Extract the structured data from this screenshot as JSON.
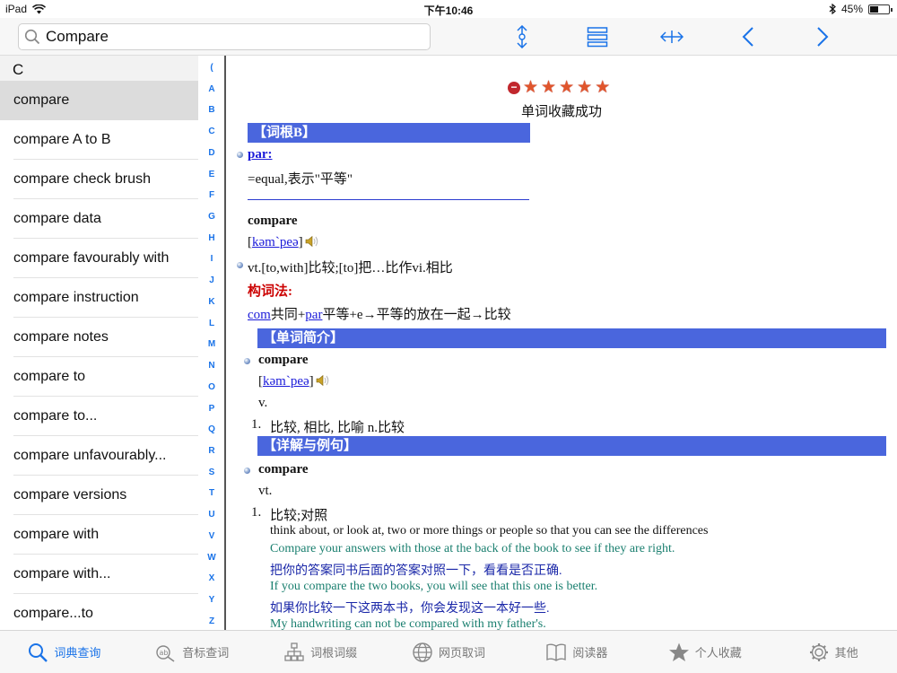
{
  "status_bar": {
    "device": "iPad",
    "time": "下午10:46",
    "battery_text": "45%",
    "battery_level": 0.45
  },
  "search": {
    "value": "Compare",
    "placeholder": ""
  },
  "toolbar": {
    "icons": [
      "expand-vertical-icon",
      "list-icon",
      "expand-horizontal-icon",
      "chevron-left-icon",
      "chevron-right-icon"
    ]
  },
  "word_list": {
    "section": "C",
    "items": [
      "compare",
      "compare A to B",
      "compare check brush",
      "compare data",
      "compare favourably with",
      "compare instruction",
      "compare notes",
      "compare to",
      "compare to...",
      "compare unfavourably...",
      "compare versions",
      "compare with",
      "compare with...",
      "compare...to"
    ],
    "selected_index": 0
  },
  "index_bar": [
    "(",
    "A",
    "B",
    "C",
    "D",
    "E",
    "F",
    "G",
    "H",
    "I",
    "J",
    "K",
    "L",
    "M",
    "N",
    "O",
    "P",
    "Q",
    "R",
    "S",
    "T",
    "U",
    "V",
    "W",
    "X",
    "Y",
    "Z"
  ],
  "entry": {
    "rating_stars": 5,
    "saved_message": "单词收藏成功",
    "root_header": "【词根B】",
    "root_word": "par:",
    "root_meaning": "=equal,表示\"平等\"",
    "headword": "compare",
    "phonetic": "kəm`peə",
    "pos_line": "vt.[to,with]比较;[to]把…比作vi.相比",
    "formation_label": "构词法:",
    "formation": {
      "part1": "com",
      "text1": "共同+",
      "part2": "par",
      "text2": "平等+e→平等的放在一起→比较"
    },
    "intro_header": "【单词简介】",
    "intro_word": "compare",
    "intro_phonetic": "kəm`peə",
    "intro_pos": "v.",
    "intro_sense_num": "1.",
    "intro_sense": "比较, 相比, 比喻 n.比较",
    "detail_header": "【详解与例句】",
    "detail_word": "compare",
    "detail_pos": "vt.",
    "detail_sense_num": "1.",
    "detail_sense": "比较;对照",
    "definition": "think about, or look at, two or more things or people so that you can see the differences",
    "examples": [
      {
        "en": "Compare your answers with those at the back of the book to see if they are right.",
        "zh": "把你的答案同书后面的答案对照一下，看看是否正确."
      },
      {
        "en": "If you compare the two books, you will see that this one is better.",
        "zh": "如果你比较一下这两本书，你会发现这一本好一些."
      },
      {
        "en": "My handwriting can not be compared with my father's.",
        "zh": ""
      }
    ]
  },
  "tabs": [
    {
      "label": "词典查询",
      "icon": "search-icon",
      "active": true
    },
    {
      "label": "音标查词",
      "icon": "phonetic-icon",
      "active": false
    },
    {
      "label": "词根词缀",
      "icon": "hierarchy-icon",
      "active": false
    },
    {
      "label": "网页取词",
      "icon": "globe-icon",
      "active": false
    },
    {
      "label": "阅读器",
      "icon": "book-icon",
      "active": false
    },
    {
      "label": "个人收藏",
      "icon": "star-icon",
      "active": false
    },
    {
      "label": "其他",
      "icon": "gear-icon",
      "active": false
    }
  ],
  "colors": {
    "accent": "#1a73e8",
    "header_bar": "#4a66dd",
    "star": "#e0552c",
    "example_en": "#1a7f6f",
    "example_zh": "#1a27a8",
    "formation_label": "#cc0000"
  }
}
